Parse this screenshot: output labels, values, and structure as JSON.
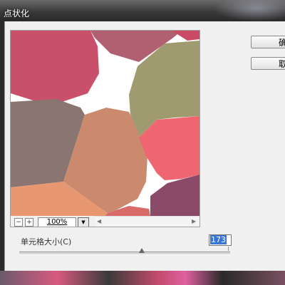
{
  "window": {
    "title": "点状化"
  },
  "buttons": {
    "ok_label": "确",
    "cancel_label": "取"
  },
  "preview": {
    "zoom": "100%",
    "zoom_out_glyph": "−",
    "zoom_in_glyph": "+",
    "cells": [
      {
        "color": "#c8506a"
      },
      {
        "color": "#b06070"
      },
      {
        "color": "#ca4a66"
      },
      {
        "color": "#a09a70"
      },
      {
        "color": "#8a7570"
      },
      {
        "color": "#cb8a6e"
      },
      {
        "color": "#f06670"
      },
      {
        "color": "#e89870"
      },
      {
        "color": "#d86a6a"
      },
      {
        "color": "#8a4a68"
      }
    ]
  },
  "parameter": {
    "label": "单元格大小(C)",
    "value": "173",
    "slider_fraction": 0.58
  }
}
